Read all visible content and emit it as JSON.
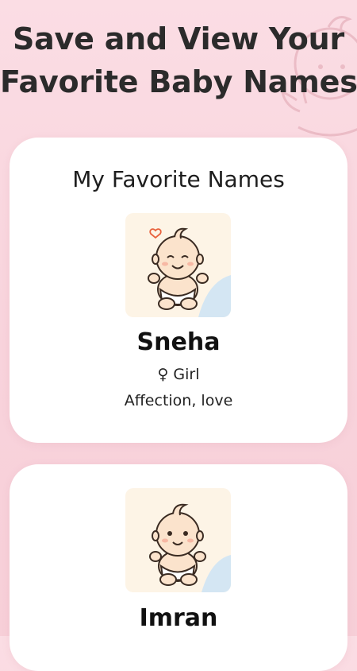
{
  "header": {
    "line1": "Save and View Your",
    "line2": "Favorite Baby Names"
  },
  "favorites": {
    "title": "My Favorite Names",
    "items": [
      {
        "name": "Sneha",
        "gender": "♀ Girl",
        "meaning": "Affection, love",
        "avatar_icon": "baby-illustration-icon"
      },
      {
        "name": "Imran",
        "avatar_icon": "baby-illustration-icon"
      }
    ]
  },
  "colors": {
    "background": "#f8d3dc",
    "card": "#ffffff",
    "avatar_bg": "#fdf4e6",
    "accent_blue": "#d4e6f3",
    "heart": "#e8613c"
  }
}
